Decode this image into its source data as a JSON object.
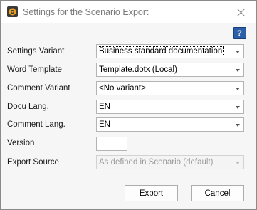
{
  "window": {
    "title": "Settings for the Scenario Export",
    "help_label": "?"
  },
  "form": {
    "settings_variant": {
      "label": "Settings Variant",
      "value": "Business standard documentation"
    },
    "word_template": {
      "label": "Word Template",
      "value": "Template.dotx (Local)"
    },
    "comment_variant": {
      "label": "Comment Variant",
      "value": "<No variant>"
    },
    "docu_lang": {
      "label": "Docu Lang.",
      "value": "EN"
    },
    "comment_lang": {
      "label": "Comment Lang.",
      "value": "EN"
    },
    "version": {
      "label": "Version",
      "value": ""
    },
    "export_source": {
      "label": "Export Source",
      "value": "As defined in Scenario (default)"
    }
  },
  "buttons": {
    "export": "Export",
    "cancel": "Cancel"
  }
}
